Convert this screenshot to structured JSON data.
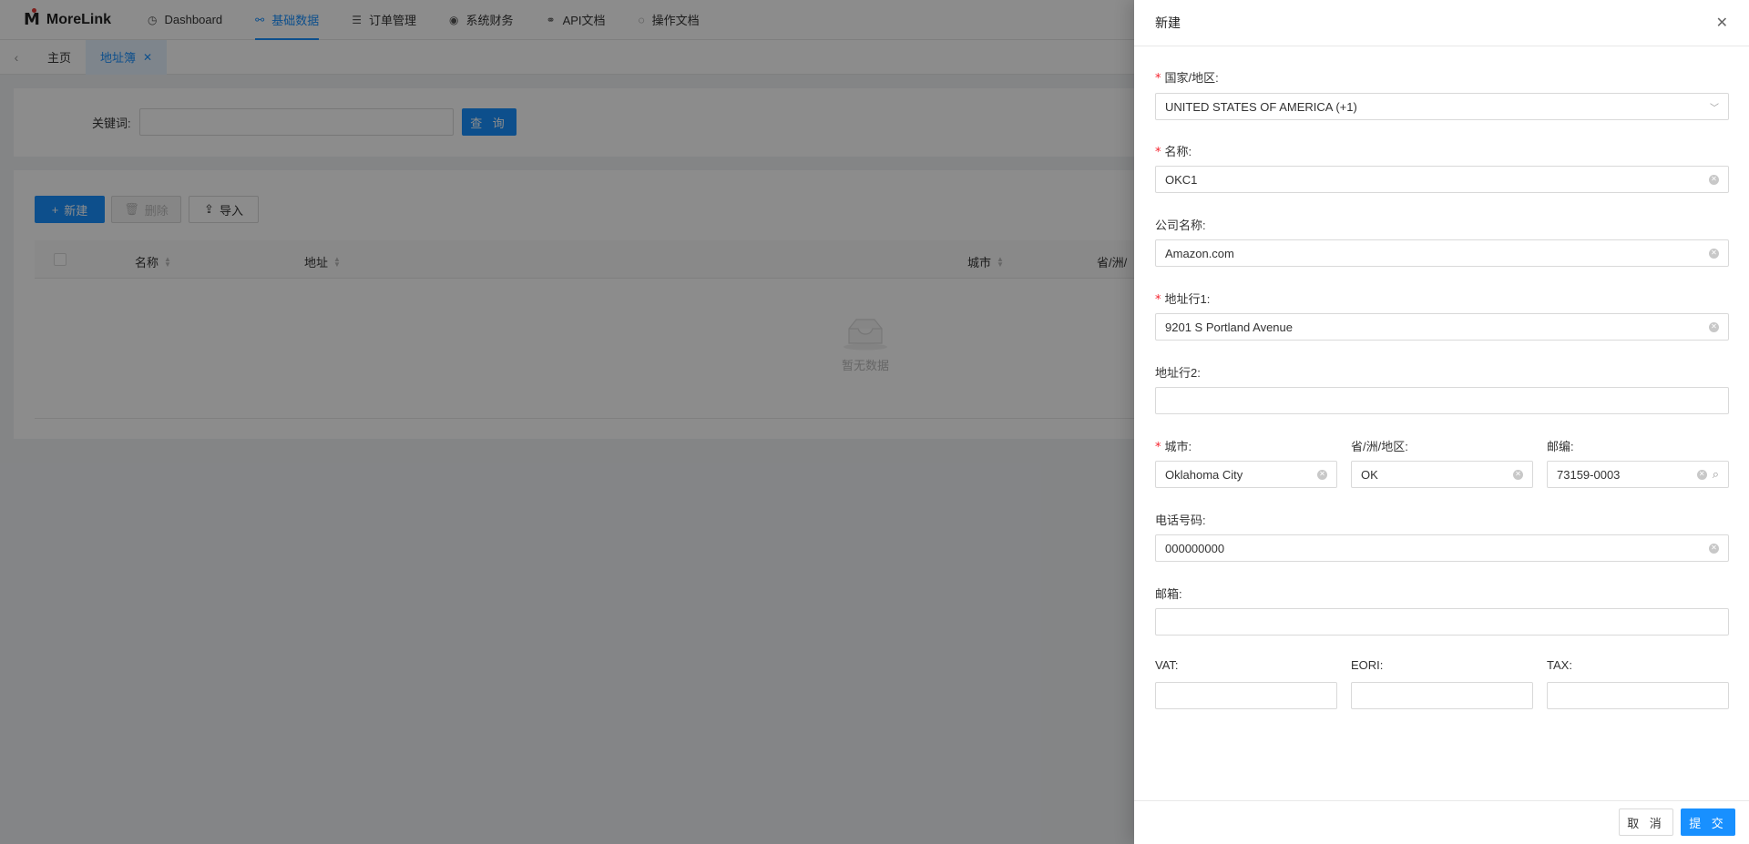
{
  "app": {
    "logo_text": "MoreLink"
  },
  "nav": [
    {
      "label": "Dashboard",
      "icon": "dashboard-icon",
      "glyph": "◷",
      "active": false
    },
    {
      "label": "基础数据",
      "icon": "data-icon",
      "glyph": "⚯",
      "active": true
    },
    {
      "label": "订单管理",
      "icon": "list-icon",
      "glyph": "☰",
      "active": false
    },
    {
      "label": "系统财务",
      "icon": "finance-icon",
      "glyph": "◉",
      "active": false
    },
    {
      "label": "API文档",
      "icon": "link-icon",
      "glyph": "⚭",
      "active": false
    },
    {
      "label": "操作文档",
      "icon": "doc-icon",
      "glyph": "◌",
      "active": false
    }
  ],
  "tabs": {
    "home": "主页",
    "address_book": "地址簿"
  },
  "search": {
    "keyword_label": "关键词:",
    "query_button": "查 询",
    "keyword_value": ""
  },
  "toolbar": {
    "new": "新建",
    "delete": "删除",
    "import": "导入"
  },
  "table": {
    "columns": [
      "名称",
      "地址",
      "城市",
      "省/洲/"
    ],
    "empty_text": "暂无数据"
  },
  "drawer": {
    "title": "新建",
    "country": {
      "label": "国家/地区:",
      "value": "UNITED STATES OF AMERICA (+1)"
    },
    "name": {
      "label": "名称:",
      "value": "OKC1"
    },
    "company": {
      "label": "公司名称:",
      "value": "Amazon.com"
    },
    "address1": {
      "label": "地址行1:",
      "value": "9201 S Portland Avenue"
    },
    "address2": {
      "label": "地址行2:",
      "value": ""
    },
    "city": {
      "label": "城市:",
      "value": "Oklahoma City"
    },
    "state": {
      "label": "省/洲/地区:",
      "value": "OK"
    },
    "zip": {
      "label": "邮编:",
      "value": "73159-0003"
    },
    "phone": {
      "label": "电话号码:",
      "value": "000000000"
    },
    "email": {
      "label": "邮箱:",
      "value": ""
    },
    "vat": {
      "label": "VAT:",
      "value": ""
    },
    "eori": {
      "label": "EORI:",
      "value": ""
    },
    "tax": {
      "label": "TAX:",
      "value": ""
    },
    "cancel": "取 消",
    "submit": "提 交"
  }
}
